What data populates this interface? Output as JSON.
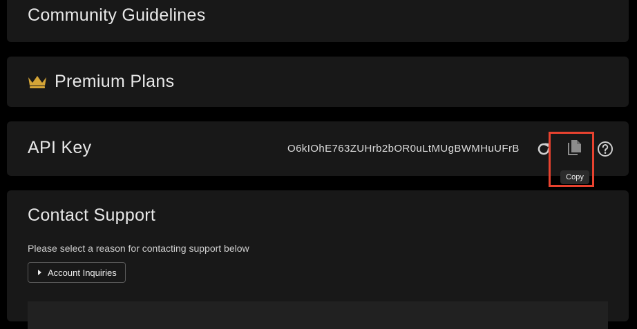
{
  "sections": {
    "guidelines": {
      "title": "Community Guidelines"
    },
    "premium": {
      "title": "Premium Plans",
      "icon": "crown-icon",
      "icon_color": "#d4a437"
    },
    "api": {
      "title": "API Key",
      "key_value": "O6kIOhE763ZUHrb2bOR0uLtMUgBWMHuUFrB",
      "refresh_icon": "refresh-icon",
      "copy_icon": "copy-icon",
      "help_icon": "help-circle-icon",
      "copy_tooltip": "Copy"
    },
    "support": {
      "title": "Contact Support",
      "description": "Please select a reason for contacting support below",
      "reason_button_label": "Account Inquiries"
    }
  },
  "colors": {
    "background": "#000000",
    "card": "#181818",
    "highlight": "#e8422f"
  }
}
